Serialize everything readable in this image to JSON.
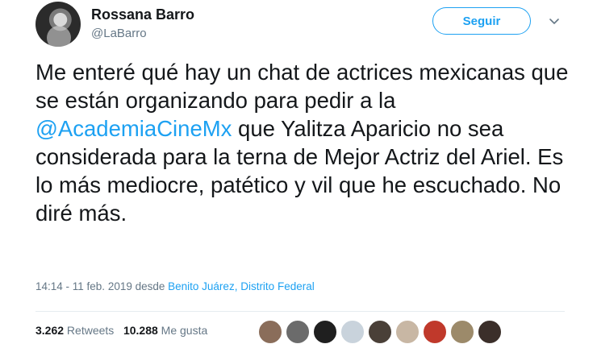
{
  "author": {
    "name": "Rossana Barro",
    "handle": "@LaBarro"
  },
  "actions": {
    "follow_label": "Seguir"
  },
  "tweet": {
    "text_before": "Me enteré qué hay un chat de actrices mexicanas que se están organizando para pedir a la ",
    "mention": "@AcademiaCineMx",
    "text_after": " que Yalitza Aparicio no sea considerada para la terna de Mejor Actriz del Ariel. Es lo más mediocre, patético y vil que he escuchado. No diré más."
  },
  "meta": {
    "timestamp": "14:14 - 11 feb. 2019 desde ",
    "location": "Benito Juárez, Distrito Federal"
  },
  "stats": {
    "retweets_count": "3.262",
    "retweets_label": " Retweets",
    "likes_count": "10.288",
    "likes_label": " Me gusta"
  },
  "colors": {
    "accent": "#1da1f2",
    "muted": "#657786",
    "text": "#14171a"
  },
  "likers": [
    {
      "color": "#8a6d5a"
    },
    {
      "color": "#6b6b6b"
    },
    {
      "color": "#1f1f1f"
    },
    {
      "color": "#c9d3dc"
    },
    {
      "color": "#4a4038"
    },
    {
      "color": "#c8b7a4"
    },
    {
      "color": "#c0392b"
    },
    {
      "color": "#9c8a6a"
    },
    {
      "color": "#3b2f2a"
    }
  ]
}
